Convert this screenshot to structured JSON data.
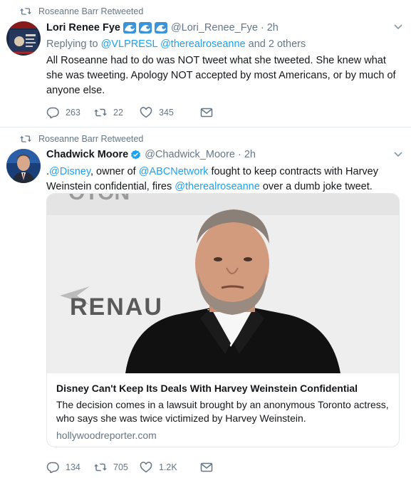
{
  "tweets": [
    {
      "retweet_context": "Roseanne Barr Retweeted",
      "name": "Lori Renee Fye",
      "name_icons": [
        "wave-icon",
        "wave-icon",
        "wave-icon"
      ],
      "handle": "@Lori_Renee_Fye",
      "separator": "·",
      "time": "2h",
      "replying_prefix": "Replying to",
      "replying_mention1": "@VLPRESL",
      "replying_mention2": "@therealroseanne",
      "replying_suffix": "and 2 others",
      "text": "All Roseanne had to do was NOT tweet what she tweeted. She knew what she was tweeting. Apology NOT accepted by most Americans, or by much of anyone else.",
      "replies": "263",
      "retweets": "22",
      "likes": "345"
    },
    {
      "retweet_context": "Roseanne Barr Retweeted",
      "name": "Chadwick Moore",
      "verified": true,
      "handle": "@Chadwick_Moore",
      "separator": "·",
      "time": "2h",
      "text_prefix": ".",
      "mention_disney": "@Disney",
      "text_mid1": ", owner of ",
      "mention_abc": "@ABCNetwork",
      "text_mid2": " fought to keep contracts with Harvey Weinstein confidential, fires ",
      "mention_roseanne": "@therealroseanne",
      "text_end": " over a dumb joke tweet.",
      "card": {
        "image_text": "RENAU",
        "image_top_text": "OTON",
        "title": "Disney Can't Keep Its Deals With Harvey Weinstein Confidential",
        "description": "The decision comes in a lawsuit brought by an anonymous Toronto actress, who says she was twice victimized by Harvey Weinstein.",
        "domain": "hollywoodreporter.com"
      },
      "replies": "134",
      "retweets": "705",
      "likes": "1.2K"
    }
  ],
  "colors": {
    "link": "#1da1f2",
    "secondary_text": "#657786",
    "primary_text": "#14171a",
    "verified_blue": "#1da1f2",
    "divider": "#e6ecf0"
  }
}
